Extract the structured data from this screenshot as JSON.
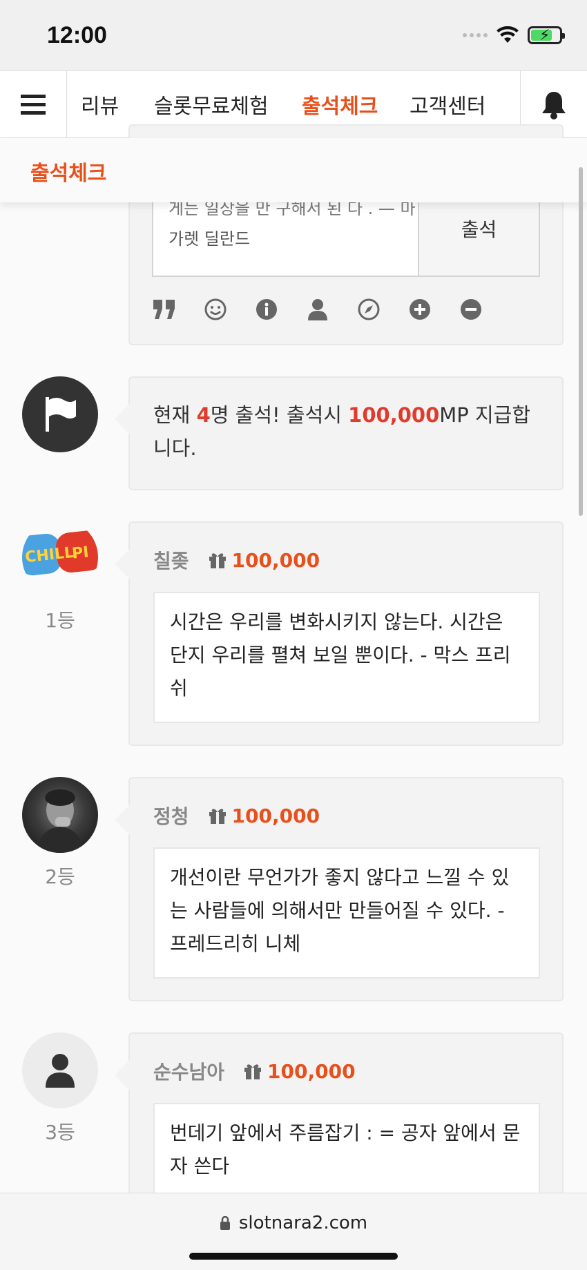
{
  "status_bar": {
    "time": "12:00"
  },
  "nav": {
    "items": [
      "리뷰",
      "슬롯무료체험",
      "출석체크",
      "고객센터"
    ],
    "active_index": 2,
    "active_color": "#e8501b"
  },
  "subheader": {
    "title": "출석체크"
  },
  "compose": {
    "text_line1": "게는 일상을 만 구해서 된 다 .  — 마",
    "text_line2": "가렛 딜란드",
    "submit_label": "출석",
    "tools": [
      "quote-icon",
      "smile-icon",
      "info-icon",
      "user-icon",
      "compass-icon",
      "plus-icon",
      "minus-icon"
    ]
  },
  "notice": {
    "prefix": "현재 ",
    "count": "4",
    "middle": "명 출석! 출석시 ",
    "points": "100,000",
    "suffix": "MP 지급합니다."
  },
  "entries": [
    {
      "rank": "1등",
      "name": "칠좆",
      "points": "100,000",
      "message": "시간은 우리를 변화시키지 않는다. 시간은 단지 우리를 펼쳐 보일 뿐이다. - 막스 프리쉬",
      "avatar": "chill-pill-avatar"
    },
    {
      "rank": "2등",
      "name": "정청",
      "points": "100,000",
      "message": "개선이란 무언가가 좋지 않다고 느낄 수 있는 사람들에 의해서만 만들어질 수 있다. - 프레드리히 니체",
      "avatar": "photo-avatar"
    },
    {
      "rank": "3등",
      "name": "순수남아",
      "points": "100,000",
      "message": "번데기 앞에서 주름잡기 : = 공자 앞에서 문자 쓴다",
      "avatar": "default-user-avatar"
    }
  ],
  "browser": {
    "url": "slotnara2.com"
  }
}
